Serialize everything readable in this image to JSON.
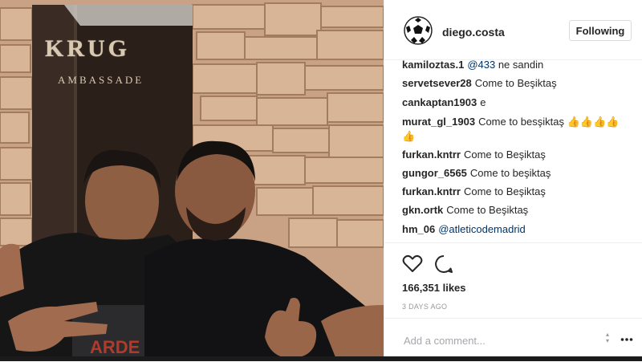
{
  "sign": {
    "brand": "KRUG",
    "subtitle": "AMBASSADE"
  },
  "post": {
    "username": "diego.costa",
    "follow_label": "Following",
    "likes": "166,351 likes",
    "timestamp": "3 DAYS AGO",
    "add_comment_placeholder": "Add a comment..."
  },
  "comments": [
    {
      "user": "kamiloztas.1",
      "mention": "@433",
      "text": " ne sandin"
    },
    {
      "user": "servetsever28",
      "mention": "",
      "text": "Come to Beşiktaş"
    },
    {
      "user": "cankaptan1903",
      "mention": "",
      "text": "e"
    },
    {
      "user": "murat_gl_1903",
      "mention": "",
      "text": "Come to besşiktaş 👍👍👍👍"
    },
    {
      "user": "",
      "mention": "",
      "text": "👍"
    },
    {
      "user": "furkan.kntrr",
      "mention": "",
      "text": "Come to Beşiktaş"
    },
    {
      "user": "gungor_6565",
      "mention": "",
      "text": "Come to beşiktaş"
    },
    {
      "user": "furkan.kntrr",
      "mention": "",
      "text": "Come to Beşiktaş"
    },
    {
      "user": "gkn.ortk",
      "mention": "",
      "text": "Come to Beşiktaş"
    },
    {
      "user": "hm_06",
      "mention": "@atleticodemadrid",
      "text": ""
    }
  ],
  "icons": {
    "like": "heart-icon",
    "comment": "comment-icon",
    "options": "more-options-icon",
    "avatar": "soccer-ball-icon"
  },
  "colors": {
    "text": "#262626",
    "mention": "#003569",
    "muted": "#999999",
    "border": "#dbdbdb"
  }
}
